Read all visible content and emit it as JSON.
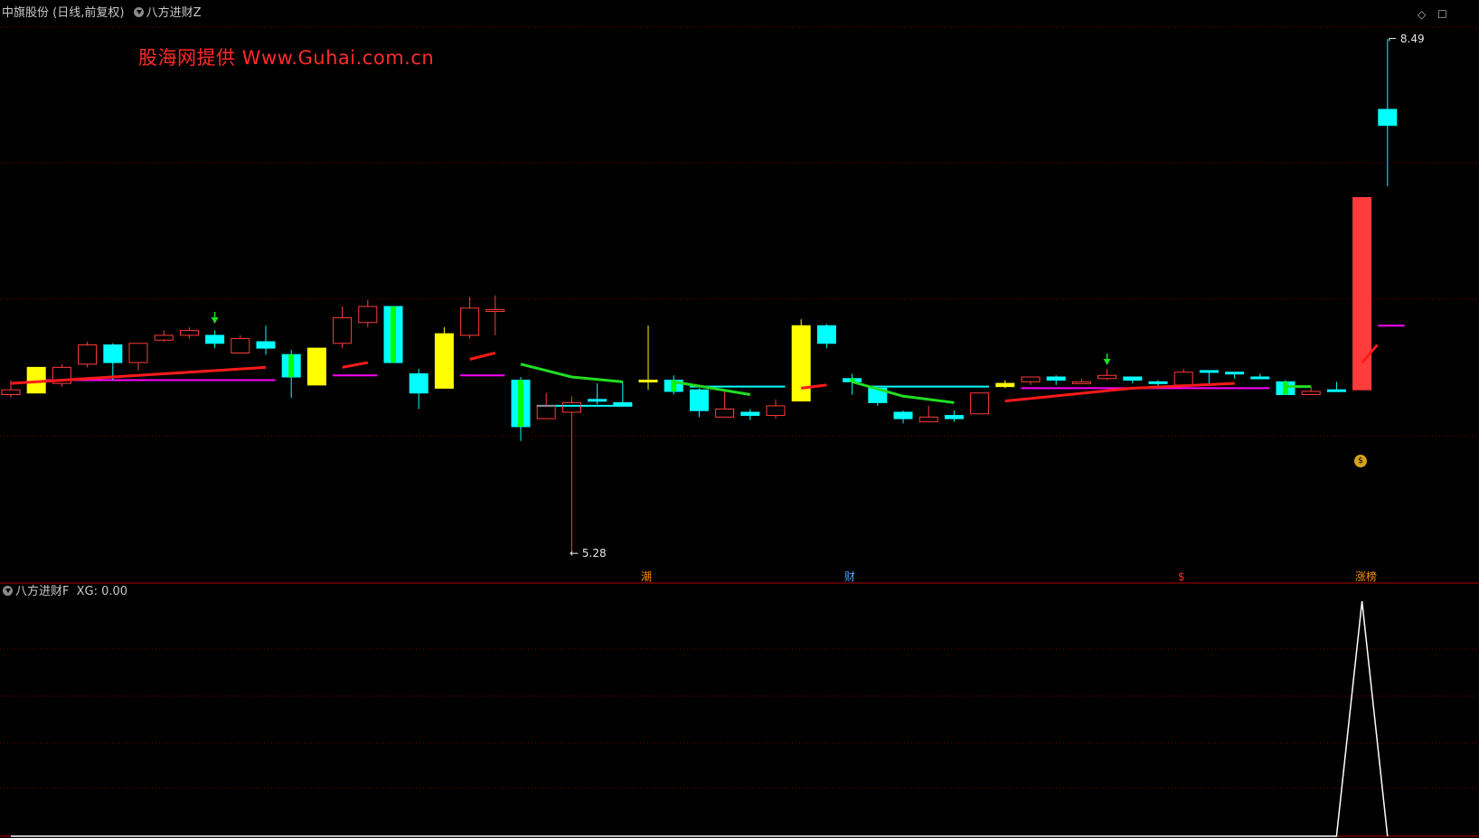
{
  "header": {
    "stock_title": "中旗股份 (日线,前复权)",
    "main_indicator": "八方进财Z"
  },
  "watermark": "股海网提供  Www.Guhai.com.cn",
  "price_labels": {
    "high": "8.49",
    "low": "5.28"
  },
  "signal_labels": [
    {
      "text": "潮",
      "color": "#ff8c00"
    },
    {
      "text": "财",
      "color": "#4aa3ff"
    },
    {
      "text": "$",
      "color": "#ff3030"
    },
    {
      "text": "涨榜",
      "color": "#ff8c00"
    }
  ],
  "sub_panel": {
    "indicator": "八方进财F",
    "value_label": "XG: 0.00"
  },
  "colors": {
    "up": "#ff3c3c",
    "down": "#00ffff",
    "yellow": "#ffff00",
    "green": "#00ff00",
    "magenta": "#ff00ff",
    "ma_red": "#ff1a1a",
    "ma_green": "#22dd22",
    "separator": "#b00000"
  },
  "icons": {
    "window_restore": "restore-icon",
    "window_close": "close-icon",
    "panel_toggle": "diamond-icon"
  },
  "chart_data": {
    "type": "candlestick",
    "y_range": [
      5.28,
      8.49
    ],
    "candles": [
      {
        "o": 6.27,
        "c": 6.3,
        "h": 6.36,
        "l": 6.25,
        "s": "up"
      },
      {
        "o": 6.28,
        "c": 6.44,
        "h": 6.44,
        "l": 6.28,
        "s": "yellow"
      },
      {
        "o": 6.34,
        "c": 6.44,
        "h": 6.46,
        "l": 6.32,
        "s": "up"
      },
      {
        "o": 6.46,
        "c": 6.58,
        "h": 6.6,
        "l": 6.44,
        "s": "up"
      },
      {
        "o": 6.58,
        "c": 6.47,
        "h": 6.59,
        "l": 6.36,
        "s": "down"
      },
      {
        "o": 6.47,
        "c": 6.59,
        "h": 6.59,
        "l": 6.42,
        "s": "up"
      },
      {
        "o": 6.61,
        "c": 6.64,
        "h": 6.67,
        "l": 6.6,
        "s": "up"
      },
      {
        "o": 6.64,
        "c": 6.67,
        "h": 6.69,
        "l": 6.62,
        "s": "up"
      },
      {
        "o": 6.64,
        "c": 6.59,
        "h": 6.67,
        "l": 6.56,
        "s": "down"
      },
      {
        "o": 6.53,
        "c": 6.62,
        "h": 6.64,
        "l": 6.53,
        "s": "up"
      },
      {
        "o": 6.6,
        "c": 6.56,
        "h": 6.7,
        "l": 6.52,
        "s": "down"
      },
      {
        "o": 6.52,
        "c": 6.38,
        "h": 6.55,
        "l": 6.25,
        "s": "green"
      },
      {
        "o": 6.33,
        "c": 6.56,
        "h": 6.56,
        "l": 6.33,
        "s": "yellow"
      },
      {
        "o": 6.59,
        "c": 6.75,
        "h": 6.82,
        "l": 6.56,
        "s": "up"
      },
      {
        "o": 6.72,
        "c": 6.82,
        "h": 6.86,
        "l": 6.69,
        "s": "up"
      },
      {
        "o": 6.82,
        "c": 6.47,
        "h": 6.82,
        "l": 6.47,
        "s": "green"
      },
      {
        "o": 6.4,
        "c": 6.28,
        "h": 6.43,
        "l": 6.18,
        "s": "down"
      },
      {
        "o": 6.31,
        "c": 6.65,
        "h": 6.69,
        "l": 6.31,
        "s": "yellow"
      },
      {
        "o": 6.64,
        "c": 6.81,
        "h": 6.88,
        "l": 6.62,
        "s": "up"
      },
      {
        "o": 6.79,
        "c": 6.8,
        "h": 6.89,
        "l": 6.64,
        "s": "up"
      },
      {
        "o": 6.36,
        "c": 6.07,
        "h": 6.38,
        "l": 5.98,
        "s": "green"
      },
      {
        "o": 6.12,
        "c": 6.2,
        "h": 6.28,
        "l": 6.12,
        "s": "up"
      },
      {
        "o": 6.16,
        "c": 6.22,
        "h": 6.26,
        "l": 5.28,
        "s": "up"
      },
      {
        "o": 6.24,
        "c": 6.24,
        "h": 6.34,
        "l": 6.21,
        "s": "down"
      },
      {
        "o": 6.22,
        "c": 6.2,
        "h": 6.35,
        "l": 6.2,
        "s": "down"
      },
      {
        "o": 6.36,
        "c": 6.36,
        "h": 6.7,
        "l": 6.3,
        "s": "yellow"
      },
      {
        "o": 6.36,
        "c": 6.29,
        "h": 6.39,
        "l": 6.27,
        "s": "green"
      },
      {
        "o": 6.3,
        "c": 6.17,
        "h": 6.31,
        "l": 6.13,
        "s": "down"
      },
      {
        "o": 6.13,
        "c": 6.18,
        "h": 6.29,
        "l": 6.13,
        "s": "up"
      },
      {
        "o": 6.16,
        "c": 6.14,
        "h": 6.18,
        "l": 6.11,
        "s": "down"
      },
      {
        "o": 6.14,
        "c": 6.2,
        "h": 6.24,
        "l": 6.12,
        "s": "up"
      },
      {
        "o": 6.23,
        "c": 6.7,
        "h": 6.74,
        "l": 6.23,
        "s": "yellow"
      },
      {
        "o": 6.7,
        "c": 6.59,
        "h": 6.71,
        "l": 6.56,
        "s": "down"
      },
      {
        "o": 6.37,
        "c": 6.35,
        "h": 6.4,
        "l": 6.27,
        "s": "green"
      },
      {
        "o": 6.31,
        "c": 6.22,
        "h": 6.31,
        "l": 6.2,
        "s": "down"
      },
      {
        "o": 6.16,
        "c": 6.12,
        "h": 6.17,
        "l": 6.09,
        "s": "down"
      },
      {
        "o": 6.1,
        "c": 6.13,
        "h": 6.2,
        "l": 6.1,
        "s": "up"
      },
      {
        "o": 6.14,
        "c": 6.12,
        "h": 6.17,
        "l": 6.1,
        "s": "down"
      },
      {
        "o": 6.15,
        "c": 6.28,
        "h": 6.28,
        "l": 6.15,
        "s": "up"
      },
      {
        "o": 6.34,
        "c": 6.32,
        "h": 6.36,
        "l": 6.31,
        "s": "yellow"
      },
      {
        "o": 6.35,
        "c": 6.38,
        "h": 6.38,
        "l": 6.33,
        "s": "up"
      },
      {
        "o": 6.38,
        "c": 6.36,
        "h": 6.39,
        "l": 6.33,
        "s": "down"
      },
      {
        "o": 6.35,
        "c": 6.35,
        "h": 6.37,
        "l": 6.34,
        "s": "up"
      },
      {
        "o": 6.37,
        "c": 6.39,
        "h": 6.43,
        "l": 6.36,
        "s": "up"
      },
      {
        "o": 6.38,
        "c": 6.36,
        "h": 6.38,
        "l": 6.34,
        "s": "down"
      },
      {
        "o": 6.35,
        "c": 6.34,
        "h": 6.36,
        "l": 6.32,
        "s": "down"
      },
      {
        "o": 6.33,
        "c": 6.41,
        "h": 6.43,
        "l": 6.32,
        "s": "up"
      },
      {
        "o": 6.42,
        "c": 6.42,
        "h": 6.42,
        "l": 6.33,
        "s": "down"
      },
      {
        "o": 6.41,
        "c": 6.4,
        "h": 6.41,
        "l": 6.37,
        "s": "down"
      },
      {
        "o": 6.38,
        "c": 6.37,
        "h": 6.4,
        "l": 6.37,
        "s": "down"
      },
      {
        "o": 6.35,
        "c": 6.27,
        "h": 6.36,
        "l": 6.27,
        "s": "green"
      },
      {
        "o": 6.27,
        "c": 6.29,
        "h": 6.32,
        "l": 6.27,
        "s": "up"
      },
      {
        "o": 6.3,
        "c": 6.3,
        "h": 6.35,
        "l": 6.29,
        "s": "down"
      },
      {
        "o": 6.3,
        "c": 7.5,
        "h": 7.5,
        "l": 6.3,
        "s": "bigup"
      },
      {
        "o": 8.05,
        "c": 7.95,
        "h": 8.49,
        "l": 7.57,
        "s": "down"
      }
    ],
    "ma_segments": [
      {
        "color": "#ff1a1a",
        "points": [
          [
            0,
            6.34
          ],
          [
            10,
            6.44
          ]
        ]
      },
      {
        "color": "#ff1a1a",
        "points": [
          [
            13,
            6.44
          ],
          [
            14,
            6.47
          ]
        ]
      },
      {
        "color": "#ff1a1a",
        "points": [
          [
            18,
            6.49
          ],
          [
            19,
            6.53
          ]
        ]
      },
      {
        "color": "#22dd22",
        "points": [
          [
            20,
            6.46
          ],
          [
            22,
            6.38
          ],
          [
            24,
            6.35
          ]
        ]
      },
      {
        "color": "#22dd22",
        "points": [
          [
            26,
            6.35
          ],
          [
            29,
            6.27
          ]
        ]
      },
      {
        "color": "#ff1a1a",
        "points": [
          [
            31,
            6.31
          ],
          [
            32,
            6.33
          ]
        ]
      },
      {
        "color": "#22dd22",
        "points": [
          [
            33,
            6.35
          ],
          [
            35,
            6.26
          ],
          [
            37,
            6.22
          ]
        ]
      },
      {
        "color": "#ff1a1a",
        "points": [
          [
            39,
            6.23
          ],
          [
            44,
            6.31
          ],
          [
            48,
            6.34
          ]
        ]
      },
      {
        "color": "#22dd22",
        "points": [
          [
            50,
            6.32
          ],
          [
            51,
            6.32
          ]
        ]
      },
      {
        "color": "#ff1a1a",
        "points": [
          [
            53,
            6.47
          ],
          [
            53.6,
            6.58
          ]
        ]
      }
    ],
    "level_lines": [
      {
        "color": "#ff00ff",
        "y": 6.36,
        "x": [
          1,
          10
        ]
      },
      {
        "color": "#ff00ff",
        "y": 6.39,
        "x": [
          13,
          14
        ]
      },
      {
        "color": "#ff00ff",
        "y": 6.39,
        "x": [
          18,
          19
        ]
      },
      {
        "color": "#00ffff",
        "y": 6.2,
        "x": [
          21,
          24
        ]
      },
      {
        "color": "#00ffff",
        "y": 6.32,
        "x": [
          27,
          30
        ]
      },
      {
        "color": "#00ffff",
        "y": 6.32,
        "x": [
          34,
          38
        ]
      },
      {
        "color": "#ff00ff",
        "y": 6.31,
        "x": [
          40,
          49
        ]
      },
      {
        "color": "#ff00ff",
        "y": 6.7,
        "x": [
          54,
          54.3
        ]
      }
    ],
    "sub_series": [
      0,
      0,
      0,
      0,
      0,
      0,
      0,
      0,
      0,
      0,
      0,
      0,
      0,
      0,
      0,
      0,
      0,
      0,
      0,
      0,
      0,
      0,
      0,
      0,
      0,
      0,
      0,
      0,
      0,
      0,
      0,
      0,
      0,
      0,
      0,
      0,
      0,
      0,
      0,
      0,
      0,
      0,
      0,
      0,
      0,
      0,
      0,
      0,
      0,
      0,
      0,
      0,
      0,
      1,
      0
    ]
  }
}
